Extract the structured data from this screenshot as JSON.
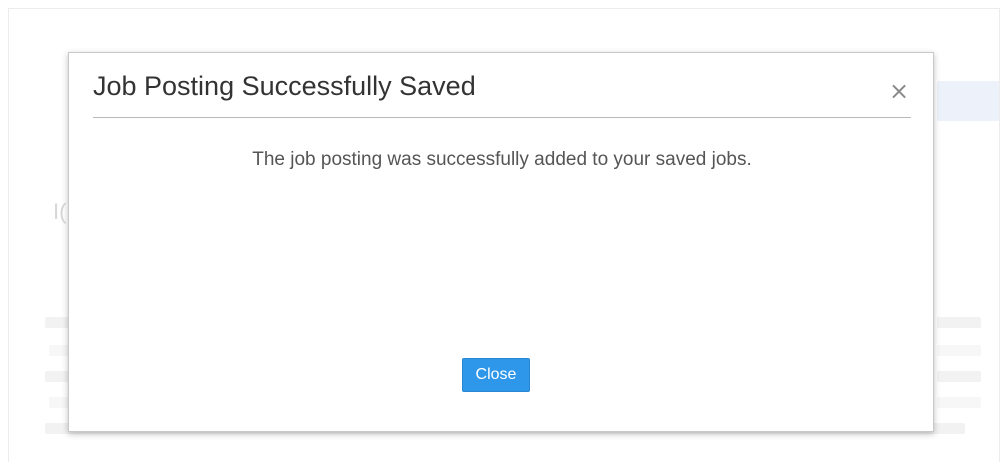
{
  "dialog": {
    "title": "Job Posting Successfully Saved",
    "close_icon": "×",
    "message": "The job posting was successfully added to your saved jobs.",
    "close_label": "Close"
  },
  "background": {
    "heading_fragment": "I("
  },
  "colors": {
    "primary_button": "#2f97ea",
    "title_text": "#333333",
    "body_text": "#555555"
  }
}
